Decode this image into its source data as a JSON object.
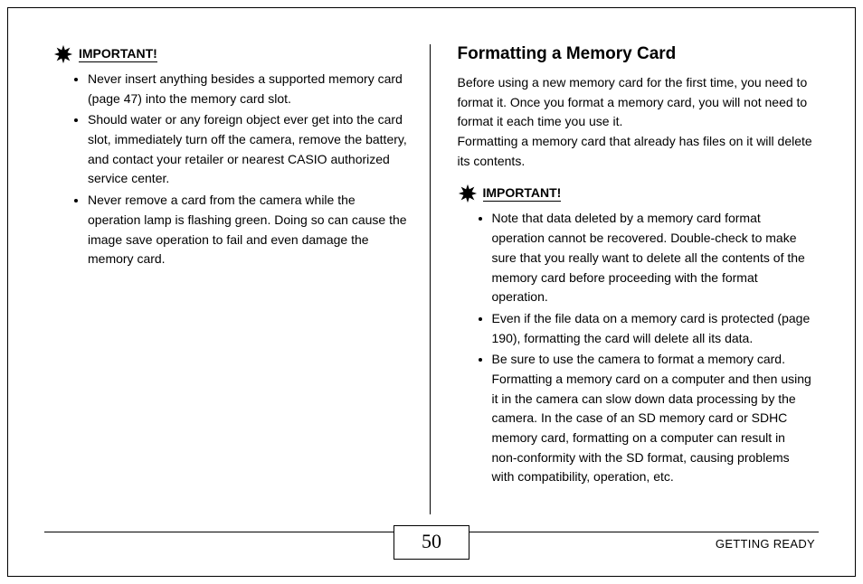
{
  "left": {
    "important_label": "IMPORTANT!",
    "items": [
      "Never insert anything besides a supported memory card (page 47) into the memory card slot.",
      "Should water or any foreign object ever get into the card slot, immediately turn off the camera, remove the battery, and contact your retailer or nearest CASIO authorized service center.",
      "Never remove a card from the camera while the operation lamp is flashing green. Doing so can cause the image save operation to fail and even damage the memory card."
    ]
  },
  "right": {
    "heading": "Formatting a Memory Card",
    "para1": "Before using a new memory card for the first time, you need to format it. Once you format a memory card, you will not need to format it each time you use it.",
    "para2": "Formatting a memory card that already has files on it will delete its contents.",
    "important_label": "IMPORTANT!",
    "items": [
      "Note that data deleted by a memory card format operation cannot be recovered. Double-check to make sure that you really want to delete all the contents of the memory card before proceeding with the format operation.",
      "Even if the file data on a memory card is protected (page 190), formatting the card will delete all its data.",
      "Be sure to use the camera to format a memory card. Formatting a memory card on a computer and then using it in the camera can slow down data processing by the camera. In the case of an SD memory card or SDHC memory card, formatting on a computer can result in non-conformity with the SD format, causing problems with compatibility, operation, etc."
    ]
  },
  "footer": {
    "page_number": "50",
    "section": "GETTING READY"
  }
}
